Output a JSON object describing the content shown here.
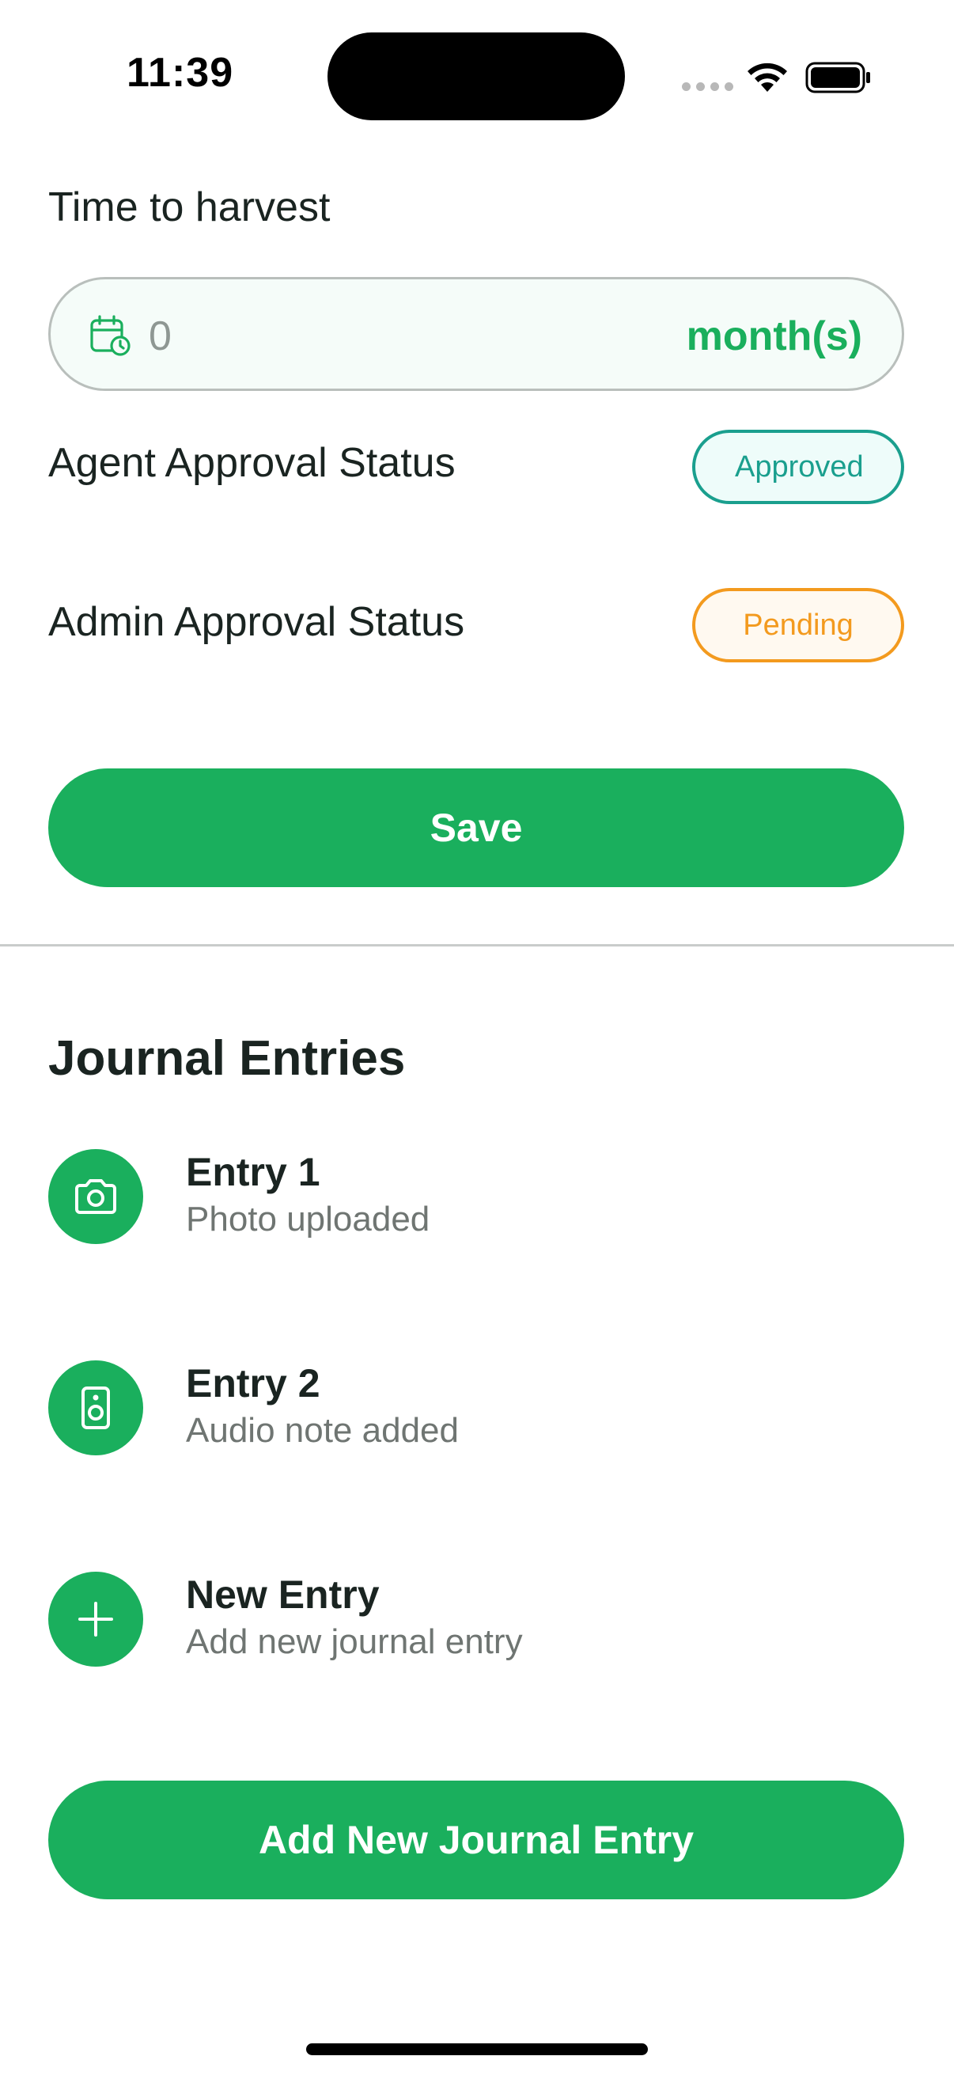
{
  "status_bar": {
    "time": "11:39"
  },
  "form": {
    "harvest_label": "Time to harvest",
    "harvest_value": "0",
    "harvest_unit": "month(s)",
    "agent_status_label": "Agent Approval Status",
    "agent_status_value": "Approved",
    "admin_status_label": "Admin Approval Status",
    "admin_status_value": "Pending",
    "save_label": "Save"
  },
  "journal": {
    "title": "Journal Entries",
    "entries": [
      {
        "title": "Entry 1",
        "subtitle": "Photo uploaded",
        "icon": "camera-icon"
      },
      {
        "title": "Entry 2",
        "subtitle": "Audio note added",
        "icon": "speaker-icon"
      },
      {
        "title": "New Entry",
        "subtitle": "Add new journal entry",
        "icon": "plus-icon"
      }
    ],
    "add_button_label": "Add New Journal Entry"
  },
  "colors": {
    "primary_green": "#1aaf5d",
    "approved_teal": "#1a9f8e",
    "pending_orange": "#f39a1e"
  }
}
